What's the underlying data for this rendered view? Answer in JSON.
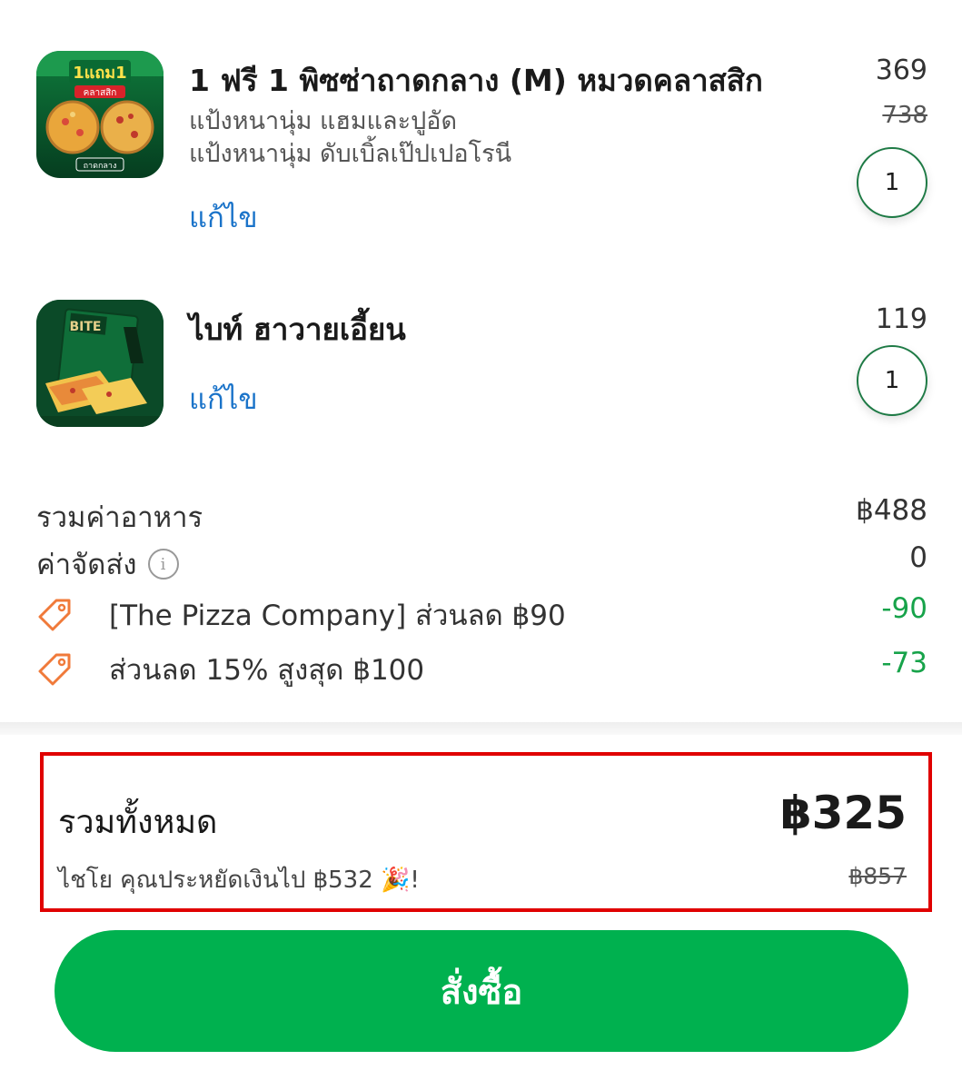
{
  "cart_items": [
    {
      "title": "1 ฟรี 1 พิซซ่าถาดกลาง (M) หมวดคลาสสิก",
      "options": [
        "แป้งหนานุ่ม แฮมและปูอัด",
        "แป้งหนานุ่ม ดับเบิ้ลเป๊ปเปอโรนี"
      ],
      "edit_label": "แก้ไข",
      "price": "369",
      "original_price": "738",
      "quantity": "1",
      "image_text_top": "1แถม1",
      "image_text_sub": "คลาสสิก",
      "image_text_bottom": "ถาดกลาง"
    },
    {
      "title": "ไบท์ ฮาวายเอี้ยน",
      "edit_label": "แก้ไข",
      "price": "119",
      "quantity": "1",
      "image_text": "BITE"
    }
  ],
  "summary": {
    "food_total_label": "รวมค่าอาหาร",
    "food_total_value": "฿488",
    "delivery_label": "ค่าจัดส่ง",
    "delivery_value": "0",
    "discounts": [
      {
        "label": "[The Pizza Company] ส่วนลด ฿90",
        "value": "-90"
      },
      {
        "label": "ส่วนลด 15% สูงสุด ฿100",
        "value": "-73"
      }
    ]
  },
  "total": {
    "label": "รวมทั้งหมด",
    "value": "฿325",
    "savings_text": "ไชโย คุณประหยัดเงินไป  ฿532 🎉!",
    "original_value": "฿857"
  },
  "order_button_label": "สั่งซื้อ",
  "colors": {
    "accent_green": "#00b14f",
    "discount_green": "#17a34a",
    "link_blue": "#1a73c9",
    "highlight_red": "#e00000",
    "tag_orange": "#f07a3a"
  }
}
